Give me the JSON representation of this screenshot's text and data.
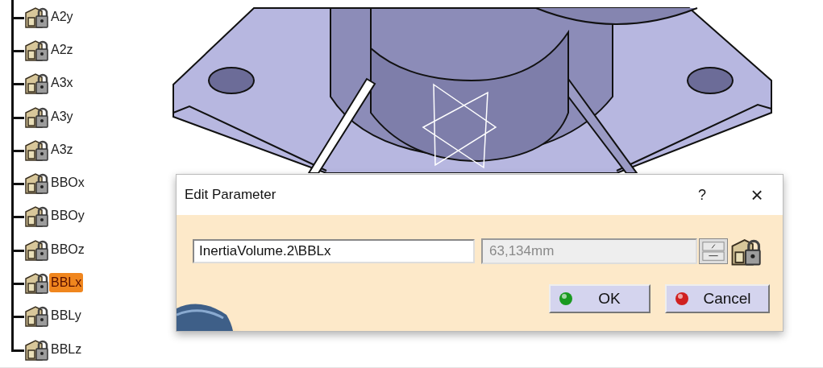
{
  "tree": {
    "items": [
      {
        "label": "A2y",
        "selected": false
      },
      {
        "label": "A2z",
        "selected": false
      },
      {
        "label": "A3x",
        "selected": false
      },
      {
        "label": "A3y",
        "selected": false
      },
      {
        "label": "A3z",
        "selected": false
      },
      {
        "label": "BBOx",
        "selected": false
      },
      {
        "label": "BBOy",
        "selected": false
      },
      {
        "label": "BBOz",
        "selected": false
      },
      {
        "label": "BBLx",
        "selected": true
      },
      {
        "label": "BBLy",
        "selected": false
      },
      {
        "label": "BBLz",
        "selected": false
      }
    ]
  },
  "dialog": {
    "title": "Edit Parameter",
    "help": "?",
    "close": "×",
    "name_field": {
      "value": "InertiaVolume.2\\BBLx"
    },
    "value_field": {
      "value": "63,134mm",
      "disabled": true
    },
    "buttons": [
      {
        "label": "OK",
        "kind": "ok"
      },
      {
        "label": "Cancel",
        "kind": "cancel"
      }
    ]
  }
}
